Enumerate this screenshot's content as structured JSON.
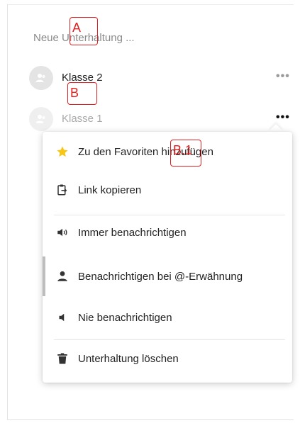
{
  "search": {
    "placeholder": "Neue Unterhaltung ..."
  },
  "conversations": [
    {
      "name": "Klasse 2",
      "more": "•••"
    },
    {
      "name": "Klasse 1",
      "more": "•••"
    }
  ],
  "menu": {
    "items": [
      {
        "label": "Zu den Favoriten hinzufügen",
        "icon": "star-icon"
      },
      {
        "label": "Link kopieren",
        "icon": "clipboard-link-icon"
      },
      {
        "label": "Immer benachrichtigen",
        "icon": "speaker-loud-icon"
      },
      {
        "label": "Benachrichtigen bei @-Erwähnung",
        "icon": "person-icon"
      },
      {
        "label": "Nie benachrichtigen",
        "icon": "speaker-off-icon"
      },
      {
        "label": "Unterhaltung löschen",
        "icon": "trash-icon"
      }
    ]
  },
  "annotations": {
    "a": "A",
    "b": "B",
    "b1": "B.1"
  },
  "colors": {
    "annotation": "#e02020",
    "star": "#f5c518",
    "avatar": "#e4e4e4"
  }
}
